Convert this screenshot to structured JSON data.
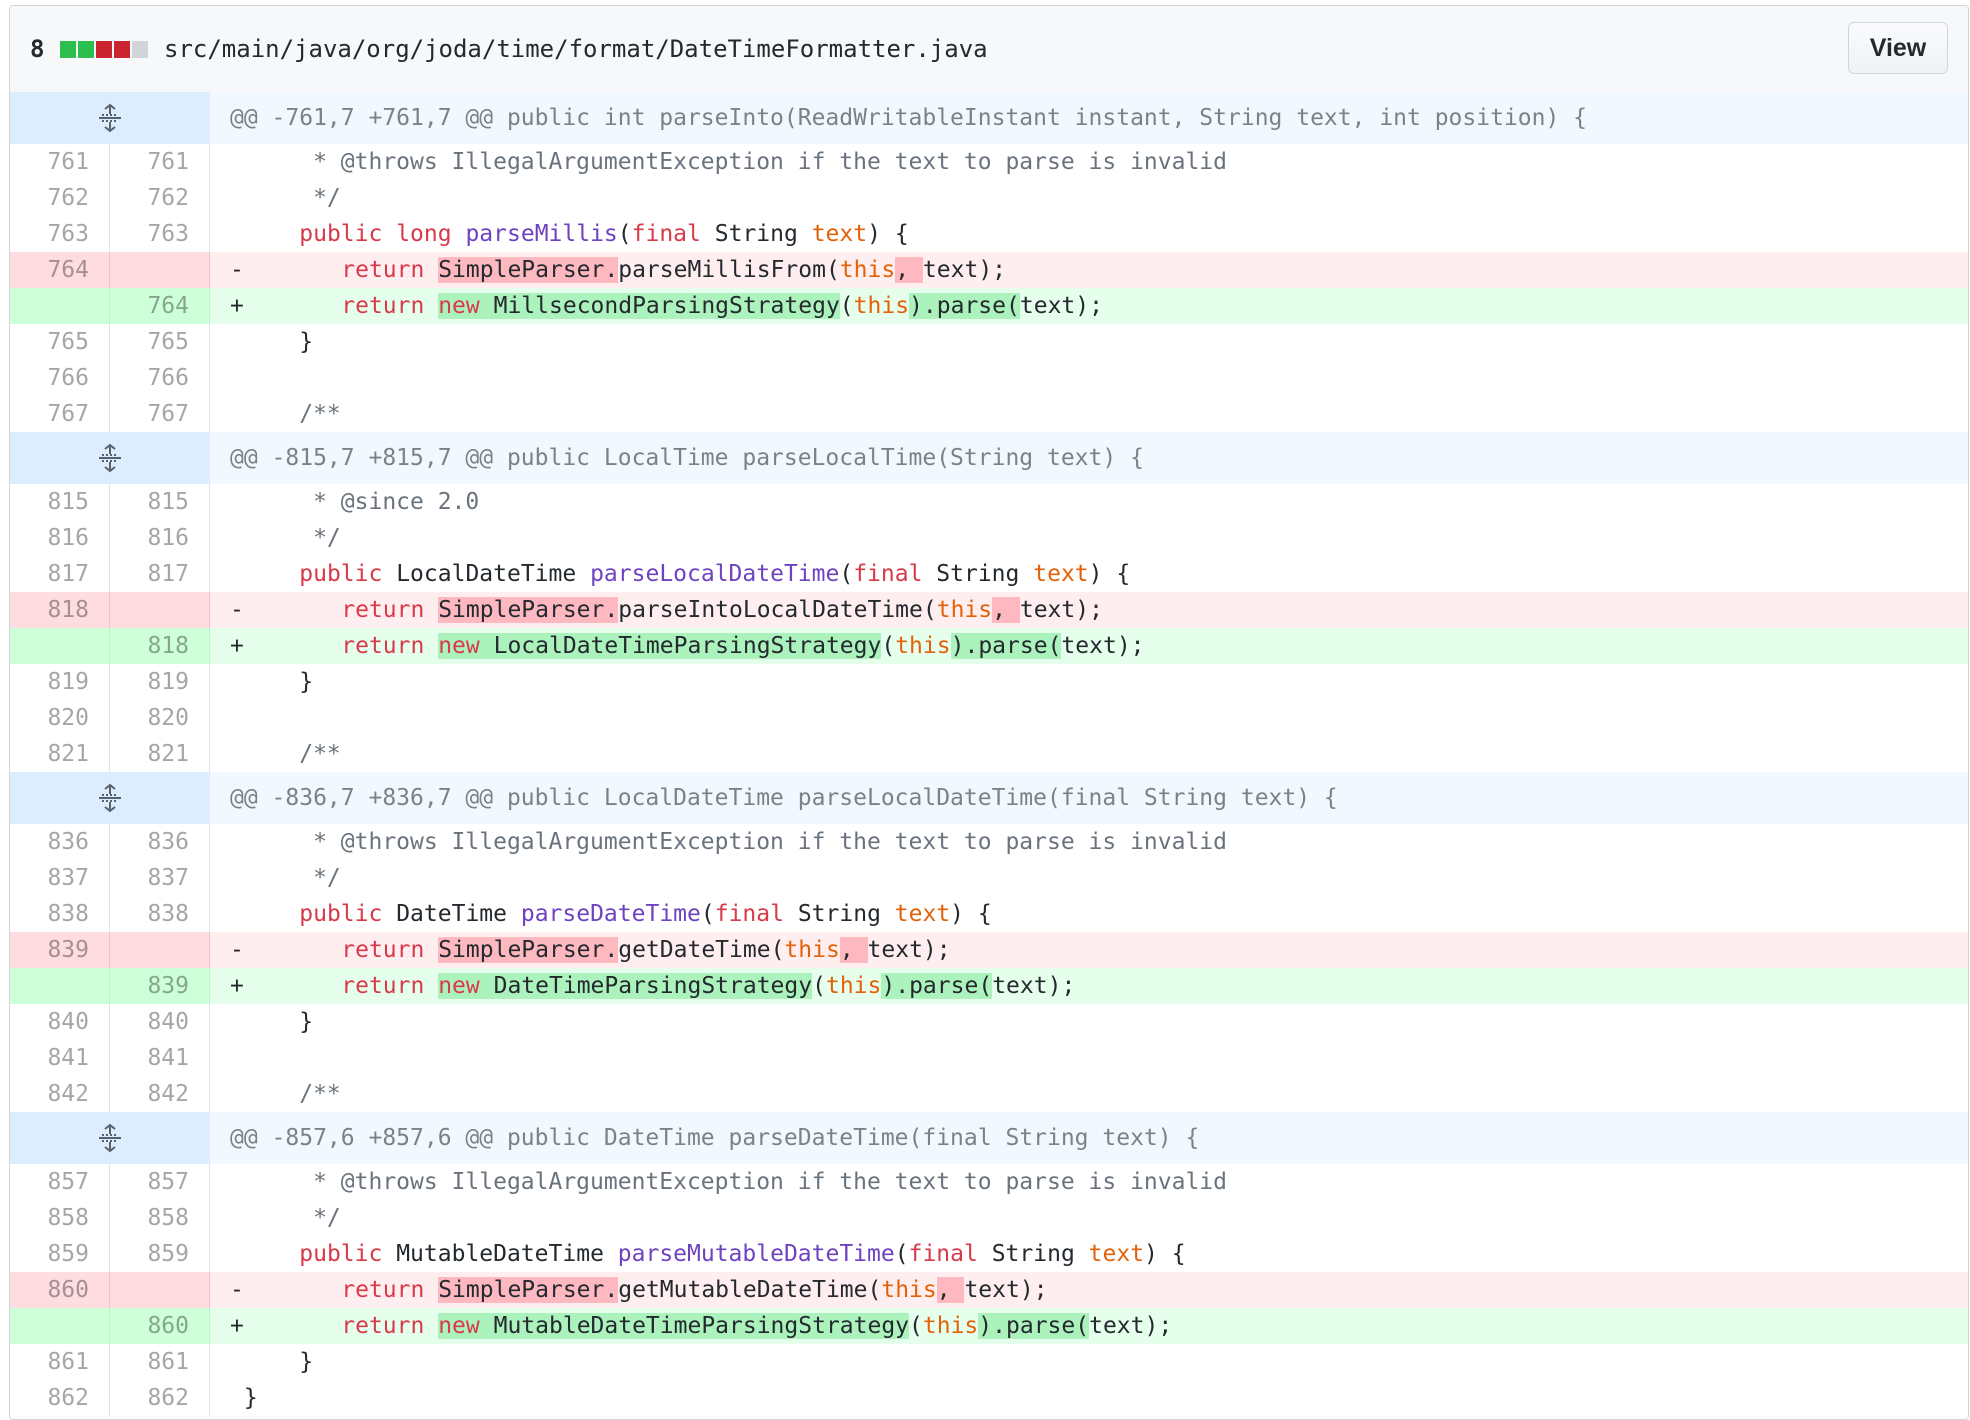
{
  "file": {
    "diffstat_count": "8",
    "diffstat_colors": [
      "#2cbe4e",
      "#2cbe4e",
      "#cb2431",
      "#cb2431",
      "#d1d5da"
    ],
    "path": "src/main/java/org/joda/time/format/DateTimeFormatter.java",
    "view_label": "View"
  },
  "hunks": [
    {
      "header": "@@ -761,7 +761,7 @@ public int parseInto(ReadWritableInstant instant, String text, int position) {",
      "lines": [
        {
          "old": "761",
          "new": "761",
          "text": "      * @throws IllegalArgumentException if the text to parse is invalid"
        },
        {
          "old": "762",
          "new": "762",
          "text": "      */"
        },
        {
          "old": "763",
          "new": "763",
          "text": "     public long parseMillis(final String text) {"
        },
        {
          "old": "764",
          "new": "",
          "text": "         return SimpleParser.parseMillisFrom(this, text);",
          "sign": "-"
        },
        {
          "old": "",
          "new": "764",
          "text": "         return new MillsecondParsingStrategy(this).parse(text);",
          "sign": "+"
        },
        {
          "old": "765",
          "new": "765",
          "text": "     }"
        },
        {
          "old": "766",
          "new": "766",
          "text": ""
        },
        {
          "old": "767",
          "new": "767",
          "text": "     /**"
        }
      ]
    },
    {
      "header": "@@ -815,7 +815,7 @@ public LocalTime parseLocalTime(String text) {",
      "lines": [
        {
          "old": "815",
          "new": "815",
          "text": "      * @since 2.0"
        },
        {
          "old": "816",
          "new": "816",
          "text": "      */"
        },
        {
          "old": "817",
          "new": "817",
          "text": "     public LocalDateTime parseLocalDateTime(final String text) {"
        },
        {
          "old": "818",
          "new": "",
          "text": "         return SimpleParser.parseIntoLocalDateTime(this, text);",
          "sign": "-"
        },
        {
          "old": "",
          "new": "818",
          "text": "         return new LocalDateTimeParsingStrategy(this).parse(text);",
          "sign": "+"
        },
        {
          "old": "819",
          "new": "819",
          "text": "     }"
        },
        {
          "old": "820",
          "new": "820",
          "text": ""
        },
        {
          "old": "821",
          "new": "821",
          "text": "     /**"
        }
      ]
    },
    {
      "header": "@@ -836,7 +836,7 @@ public LocalDateTime parseLocalDateTime(final String text) {",
      "lines": [
        {
          "old": "836",
          "new": "836",
          "text": "      * @throws IllegalArgumentException if the text to parse is invalid"
        },
        {
          "old": "837",
          "new": "837",
          "text": "      */"
        },
        {
          "old": "838",
          "new": "838",
          "text": "     public DateTime parseDateTime(final String text) {"
        },
        {
          "old": "839",
          "new": "",
          "text": "         return SimpleParser.getDateTime(this, text);",
          "sign": "-"
        },
        {
          "old": "",
          "new": "839",
          "text": "         return new DateTimeParsingStrategy(this).parse(text);",
          "sign": "+"
        },
        {
          "old": "840",
          "new": "840",
          "text": "     }"
        },
        {
          "old": "841",
          "new": "841",
          "text": ""
        },
        {
          "old": "842",
          "new": "842",
          "text": "     /**"
        }
      ]
    },
    {
      "header": "@@ -857,6 +857,6 @@ public DateTime parseDateTime(final String text) {",
      "lines": [
        {
          "old": "857",
          "new": "857",
          "text": "      * @throws IllegalArgumentException if the text to parse is invalid"
        },
        {
          "old": "858",
          "new": "858",
          "text": "      */"
        },
        {
          "old": "859",
          "new": "859",
          "text": "     public MutableDateTime parseMutableDateTime(final String text) {"
        },
        {
          "old": "860",
          "new": "",
          "text": "         return SimpleParser.getMutableDateTime(this, text);",
          "sign": "-"
        },
        {
          "old": "",
          "new": "860",
          "text": "         return new MutableDateTimeParsingStrategy(this).parse(text);",
          "sign": "+"
        },
        {
          "old": "861",
          "new": "861",
          "text": "     }"
        },
        {
          "old": "862",
          "new": "862",
          "text": " }"
        }
      ]
    }
  ]
}
